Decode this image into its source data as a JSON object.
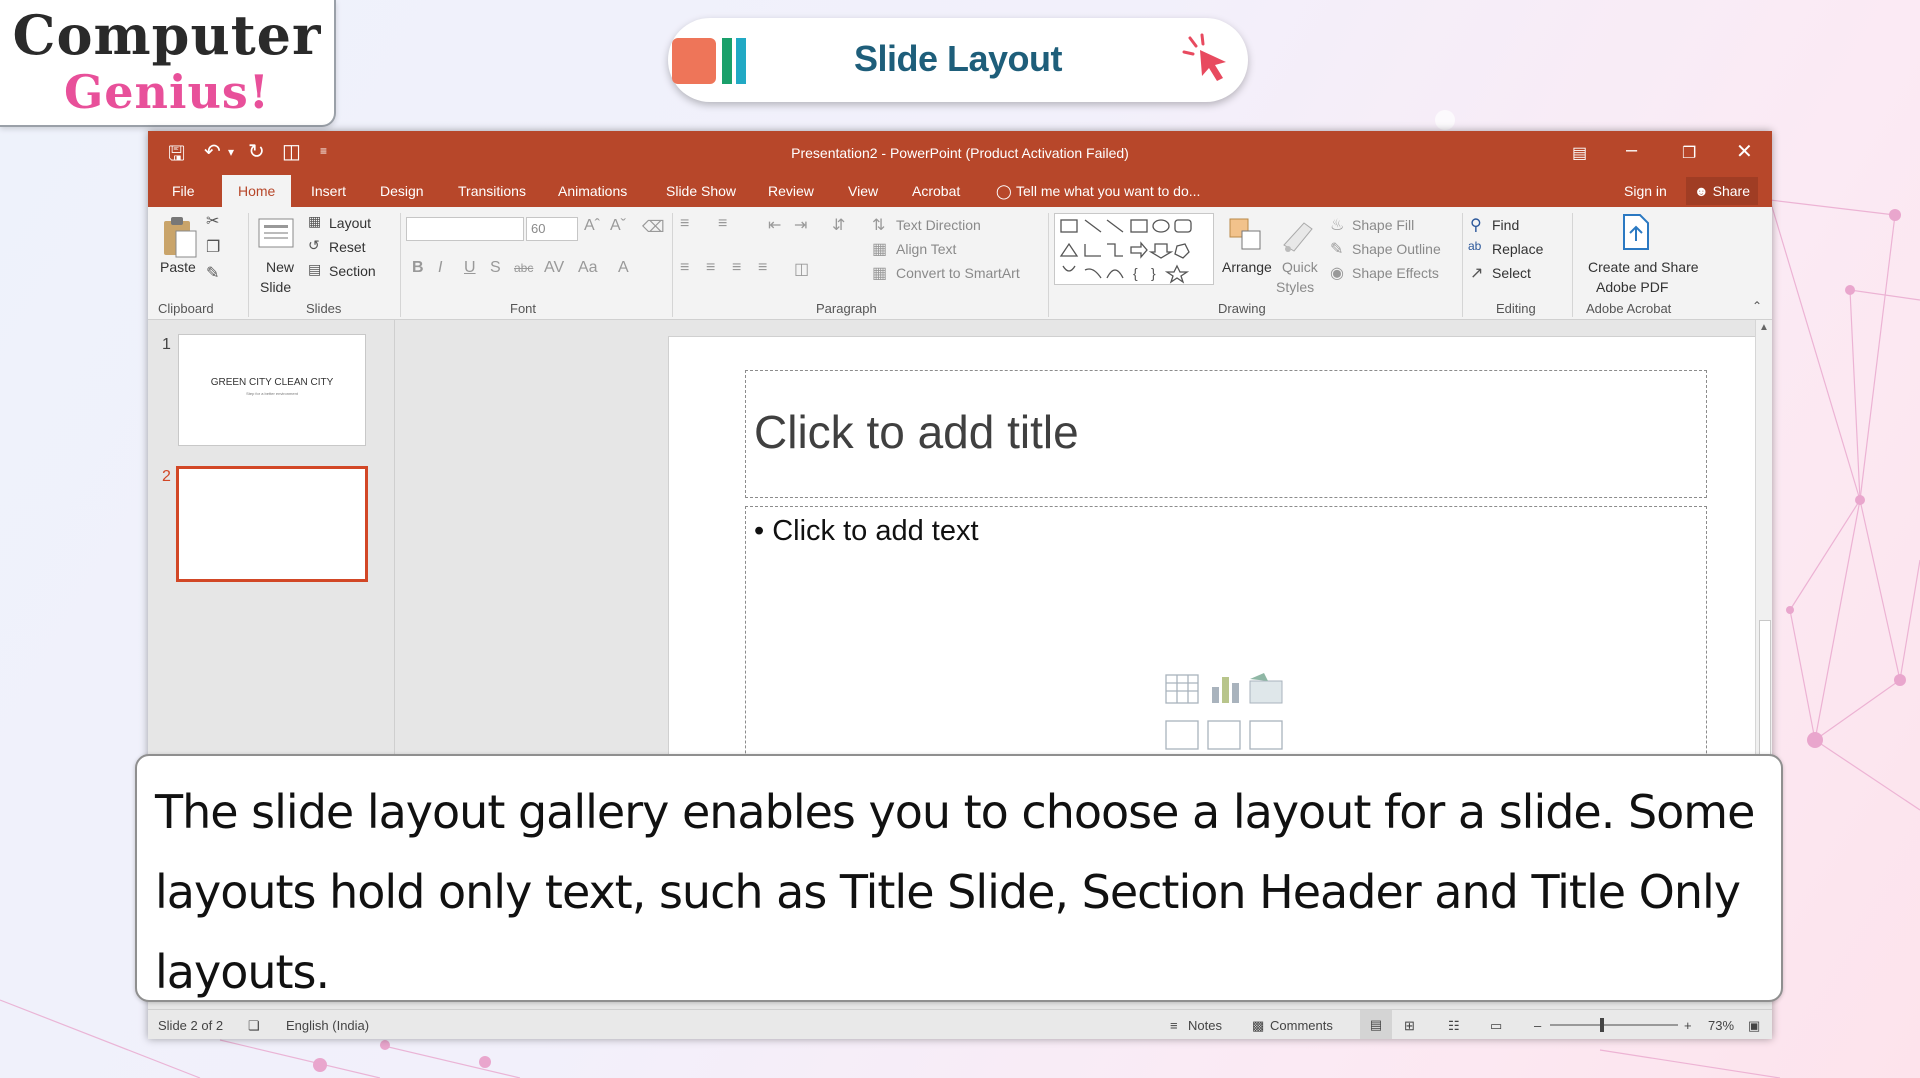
{
  "brand": {
    "line1": "Computer",
    "line2": "Genius!"
  },
  "header": {
    "title": "Slide Layout"
  },
  "window": {
    "title": "Presentation2 - PowerPoint (Product Activation Failed)",
    "qat": {
      "more_symbol": "≡"
    }
  },
  "tabs": [
    {
      "label": "File"
    },
    {
      "label": "Home"
    },
    {
      "label": "Insert"
    },
    {
      "label": "Design"
    },
    {
      "label": "Transitions"
    },
    {
      "label": "Animations"
    },
    {
      "label": "Slide Show"
    },
    {
      "label": "Review"
    },
    {
      "label": "View"
    },
    {
      "label": "Acrobat"
    }
  ],
  "tell_me": "Tell me what you want to do...",
  "sign_in": "Sign in",
  "share": "Share",
  "ribbon": {
    "clipboard": {
      "paste": "Paste",
      "group": "Clipboard"
    },
    "slides": {
      "new_slide_1": "New",
      "new_slide_2": "Slide",
      "layout": "Layout",
      "reset": "Reset",
      "section": "Section",
      "group": "Slides"
    },
    "font": {
      "size": "60",
      "group": "Font"
    },
    "paragraph": {
      "text_direction": "Text Direction",
      "align_text": "Align Text",
      "convert_smartart": "Convert to SmartArt",
      "group": "Paragraph"
    },
    "drawing": {
      "arrange": "Arrange",
      "quick_1": "Quick",
      "quick_2": "Styles",
      "shape_fill": "Shape Fill",
      "shape_outline": "Shape Outline",
      "shape_effects": "Shape Effects",
      "group": "Drawing"
    },
    "editing": {
      "find": "Find",
      "replace": "Replace",
      "select": "Select",
      "group": "Editing"
    },
    "acrobat": {
      "line1": "Create and Share",
      "line2": "Adobe PDF",
      "group": "Adobe Acrobat"
    }
  },
  "thumbnails": [
    {
      "num": "1",
      "title": "GREEN CITY CLEAN CITY",
      "subtitle": "Step for a better environment"
    },
    {
      "num": "2"
    }
  ],
  "slide": {
    "title_placeholder": "Click to add title",
    "body_placeholder": "• Click to add text"
  },
  "status": {
    "slide_count": "Slide 2 of 2",
    "language": "English (India)",
    "notes": "Notes",
    "comments": "Comments",
    "zoom": "73%"
  },
  "caption": "The slide layout gallery enables you to choose a layout for a slide. Some layouts hold only text, such as Title Slide, Section Header and Title Only layouts.",
  "colors": {
    "accent": "#B7472A",
    "selected_thumb": "#D24726",
    "pill_title": "#1E5E7A",
    "brand_pink": "#E8509A"
  }
}
